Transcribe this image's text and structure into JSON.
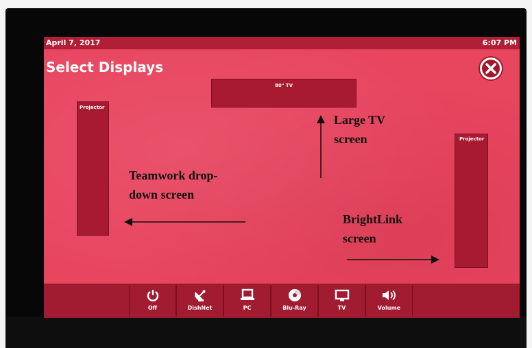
{
  "status_bar": {
    "date": "April 7, 2017",
    "time": "6:07 PM"
  },
  "page": {
    "title": "Select Displays",
    "close_label": "X"
  },
  "displays": {
    "tv_label": "80\" TV",
    "projector_left_label": "Projector",
    "projector_right_label": "Projector"
  },
  "annotations": {
    "tv": [
      "Large TV",
      "screen"
    ],
    "teamwork": [
      "Teamwork drop-",
      "down screen"
    ],
    "brightlink": [
      "BrightLink",
      "screen"
    ]
  },
  "bottom_nav": [
    {
      "label": "Off",
      "icon": "power-icon"
    },
    {
      "label": "DishNet",
      "icon": "satellite-dish-icon"
    },
    {
      "label": "PC",
      "icon": "laptop-icon"
    },
    {
      "label": "Blu-Ray",
      "icon": "disc-icon"
    },
    {
      "label": "TV",
      "icon": "tv-icon"
    },
    {
      "label": "Volume",
      "icon": "volume-icon"
    }
  ],
  "colors": {
    "screen_bg": "#e8455f",
    "status_bar": "#b01f36",
    "tile": "#a81a30",
    "nav_bar": "#9c1a2f"
  }
}
